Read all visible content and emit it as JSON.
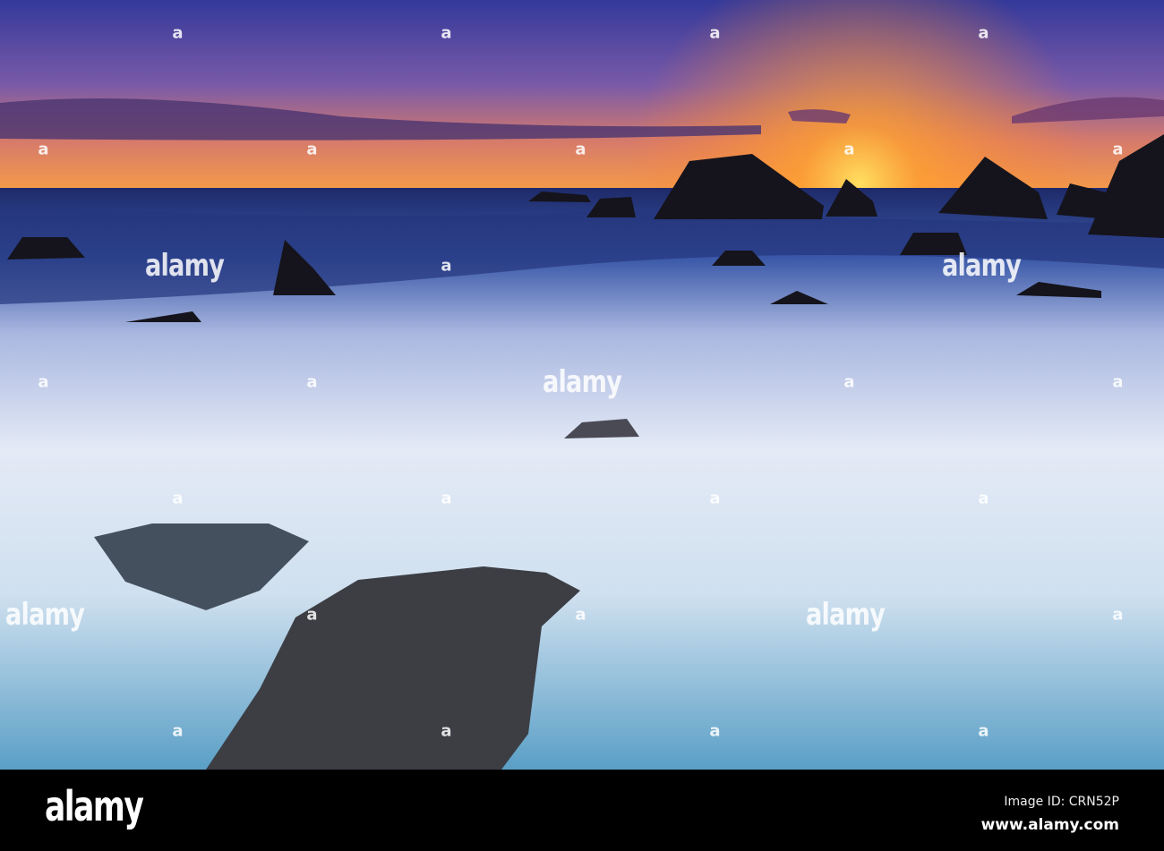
{
  "watermark": {
    "small": "a",
    "large": "alamy"
  },
  "footer": {
    "logo": "alamy",
    "image_id": "Image ID: CRN52P",
    "url": "www.alamy.com"
  },
  "colors": {
    "sky_top": "#3b3f9c",
    "sky_horizon": "#f59a3a",
    "sun": "#ffd24a",
    "sea_dark": "#1b2b6e",
    "foam": "#dfe8f6",
    "rock": "#1a1a22"
  }
}
